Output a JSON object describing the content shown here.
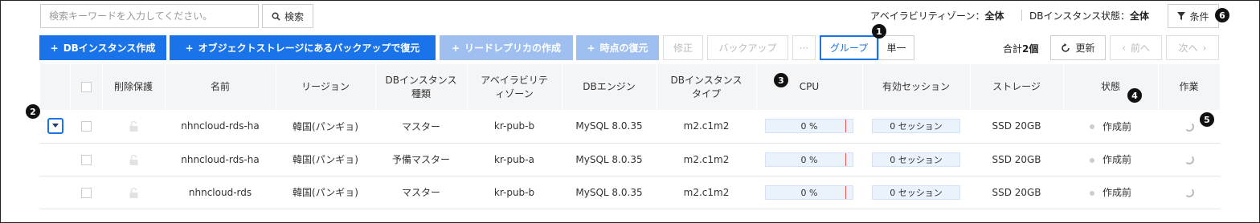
{
  "search": {
    "placeholder": "検索キーワードを入力してください。",
    "button_label": "検索"
  },
  "filters": {
    "az_label": "アベイラビリティゾーン：",
    "az_value": "全体",
    "state_label": "DBインスタンス状態：",
    "state_value": "全体",
    "condition_label": "条件"
  },
  "toolbar": {
    "create": "DBインスタンス作成",
    "restore_backup": "オブジェクトストレージにあるバックアップで復元",
    "read_replica": "リードレプリカの作成",
    "point_restore": "時点の復元",
    "modify": "修正",
    "backup": "バックアップ",
    "more": "···",
    "group": "グループ",
    "single": "単一"
  },
  "paging": {
    "total_prefix": "合計",
    "total_count": "2個",
    "refresh": "更新",
    "prev": "前へ",
    "next": "次へ"
  },
  "table": {
    "headers": {
      "delete_protect": "削除保護",
      "name": "名前",
      "region": "リージョン",
      "instance_kind_1": "DBインスタンス",
      "instance_kind_2": "種類",
      "az_1": "アベイラビリテ",
      "az_2": "ィゾーン",
      "engine": "DBエンジン",
      "instance_type_1": "DBインスタンス",
      "instance_type_2": "タイプ",
      "cpu": "CPU",
      "sessions": "有効セッション",
      "storage": "ストレージ",
      "state": "状態",
      "action": "作業"
    },
    "rows": [
      {
        "name": "nhncloud-rds-ha",
        "region": "韓国(パンギョ)",
        "kind": "マスター",
        "az": "kr-pub-b",
        "engine": "MySQL 8.0.35",
        "type": "m2.c1m2",
        "cpu": "0 %",
        "sessions": "0 セッション",
        "storage": "SSD 20GB",
        "state": "作成前"
      },
      {
        "name": "nhncloud-rds-ha",
        "region": "韓国(パンギョ)",
        "kind": "予備マスター",
        "az": "kr-pub-a",
        "engine": "MySQL 8.0.35",
        "type": "m2.c1m2",
        "cpu": "0 %",
        "sessions": "0 セッション",
        "storage": "SSD 20GB",
        "state": "作成前"
      },
      {
        "name": "nhncloud-rds",
        "region": "韓国(パンギョ)",
        "kind": "マスター",
        "az": "kr-pub-b",
        "engine": "MySQL 8.0.35",
        "type": "m2.c1m2",
        "cpu": "0 %",
        "sessions": "0 セッション",
        "storage": "SSD 20GB",
        "state": "作成前"
      }
    ]
  },
  "markers": [
    "1",
    "2",
    "3",
    "4",
    "5",
    "6"
  ],
  "colors": {
    "accent": "#1a73e8",
    "accent_disabled": "#9ebff0",
    "header_bg": "#f4f5f7"
  }
}
